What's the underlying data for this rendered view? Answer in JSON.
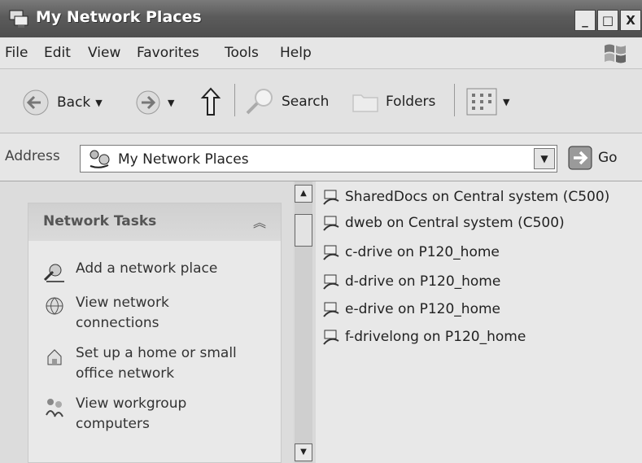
{
  "window": {
    "title": "My Network Places",
    "controls": [
      "_",
      "□",
      "X"
    ]
  },
  "menu": [
    "File",
    "Edit",
    "View",
    "Favorites",
    "Tools",
    "Help"
  ],
  "toolbar": {
    "back_label": "Back",
    "search_label": "Search",
    "folders_label": "Folders"
  },
  "address": {
    "label": "Address",
    "value": "My Network Places",
    "go_label": "Go"
  },
  "tasks": {
    "header": "Network Tasks",
    "items": [
      {
        "label": "Add a network place",
        "icon": "add-network-place-icon"
      },
      {
        "label": "View network connections",
        "icon": "network-connections-icon"
      },
      {
        "label": "Set up a home or small office network",
        "icon": "home-network-icon"
      },
      {
        "label": "View workgroup computers",
        "icon": "workgroup-computers-icon"
      }
    ]
  },
  "files": [
    "SharedDocs on Central system (C500)",
    "dweb on Central system (C500)",
    "c-drive on P120_home",
    "d-drive on P120_home",
    "e-drive on P120_home",
    "f-drivelong on P120_home"
  ]
}
